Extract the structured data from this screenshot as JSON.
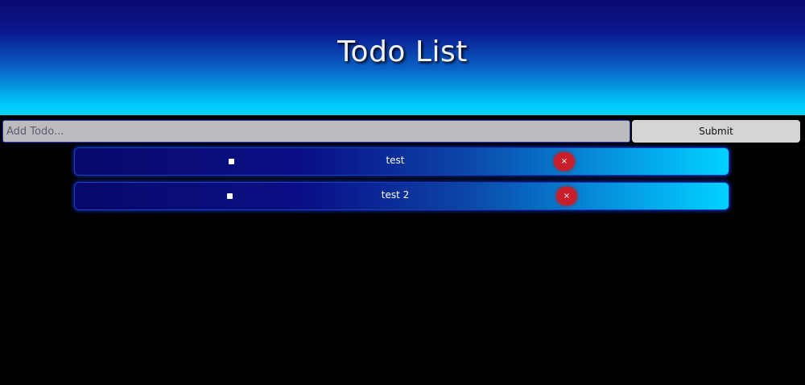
{
  "header": {
    "title": "Todo List"
  },
  "form": {
    "input_placeholder": "Add Todo...",
    "input_value": "",
    "submit_label": "Submit"
  },
  "todos": [
    {
      "text": "test",
      "completed": false,
      "delete_label": "×"
    },
    {
      "text": "test 2",
      "completed": false,
      "delete_label": "×"
    }
  ],
  "colors": {
    "background": "#000000",
    "header_top": "#0a0a6e",
    "header_bottom": "#00d4ff",
    "item_left": "#08086a",
    "item_right": "#00d2ff",
    "delete": "#c8202a"
  }
}
